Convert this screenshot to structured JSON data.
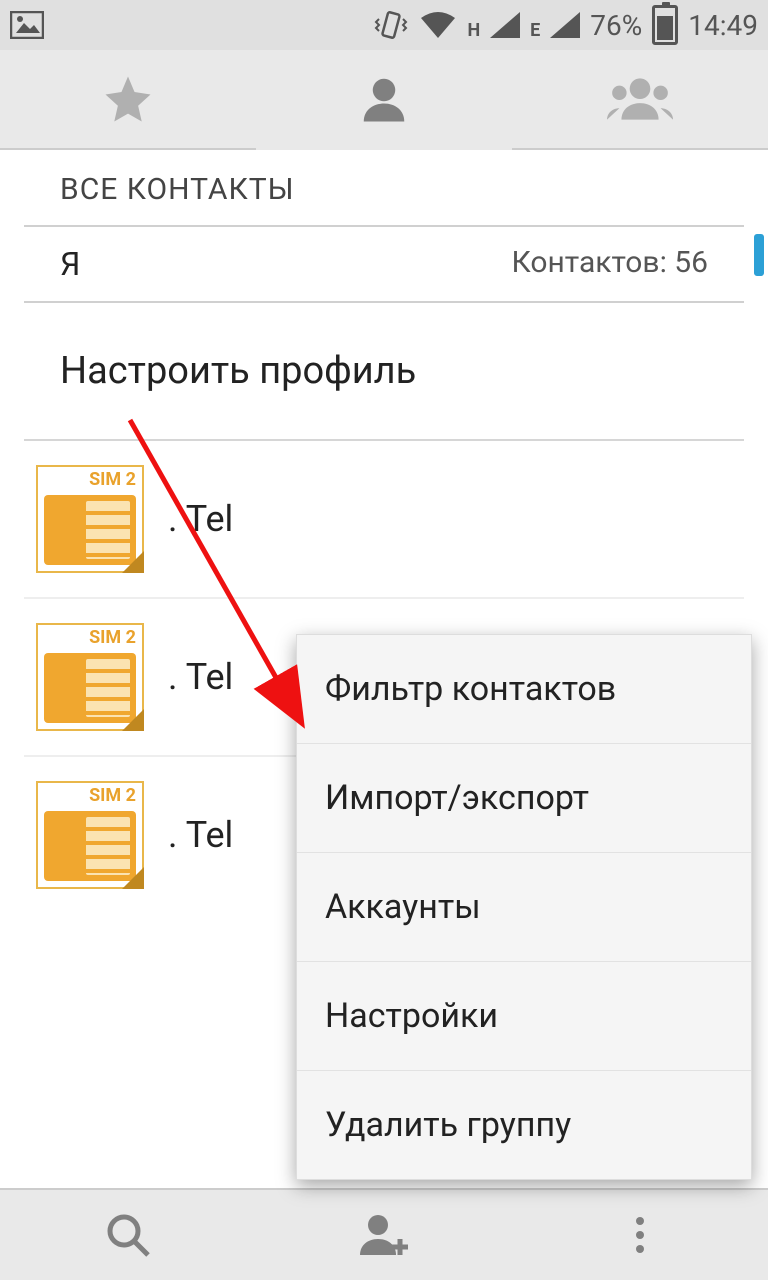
{
  "statusbar": {
    "net1_letter": "H",
    "net2_letter": "E",
    "battery": "76%",
    "time": "14:49"
  },
  "content": {
    "header": "ВСЕ КОНТАКТЫ",
    "me_label": "Я",
    "count_text": "Контактов: 56",
    "setup_profile": "Настроить профиль"
  },
  "contacts": [
    {
      "sim_label": "SIM 2",
      "name": ". Tel"
    },
    {
      "sim_label": "SIM 2",
      "name": ". Tel"
    },
    {
      "sim_label": "SIM 2",
      "name": ". Tel"
    }
  ],
  "menu": [
    "Фильтр контактов",
    "Импорт/экспорт",
    "Аккаунты",
    "Настройки",
    "Удалить группу"
  ]
}
